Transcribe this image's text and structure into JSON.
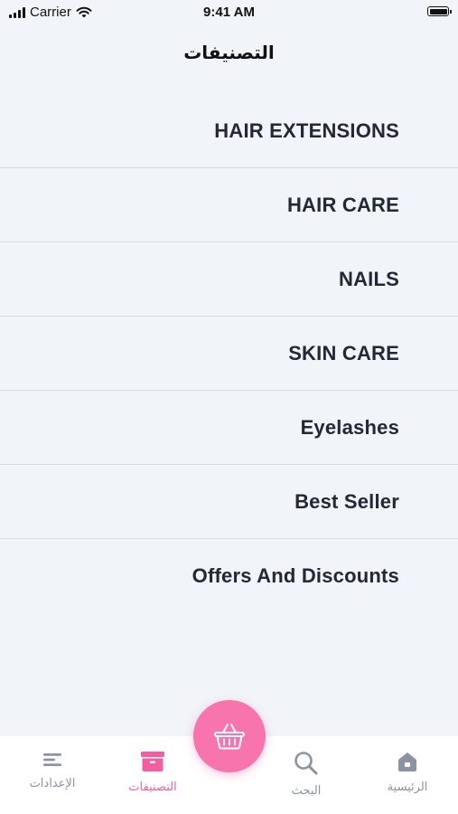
{
  "status_bar": {
    "carrier": "Carrier",
    "time": "9:41 AM"
  },
  "header": {
    "title": "التصنيفات"
  },
  "categories": [
    {
      "label": "HAIR EXTENSIONS"
    },
    {
      "label": "HAIR CARE"
    },
    {
      "label": "NAILS"
    },
    {
      "label": "SKIN CARE"
    },
    {
      "label": "Eyelashes"
    },
    {
      "label": "Best Seller"
    },
    {
      "label": "Offers And Discounts"
    }
  ],
  "tab_bar": {
    "settings": {
      "label": "الإعدادات",
      "icon": "menu-icon"
    },
    "categories": {
      "label": "التصنيفات",
      "icon": "archive-icon",
      "active": true
    },
    "cart": {
      "icon": "basket-icon"
    },
    "search": {
      "label": "البحث",
      "icon": "search-icon"
    },
    "home": {
      "label": "الرئيسية",
      "icon": "home-icon"
    }
  },
  "colors": {
    "accent": "#f25ea0",
    "fab": "#f774ad",
    "background": "#f1f4f9",
    "inactive": "#8b93a3"
  }
}
